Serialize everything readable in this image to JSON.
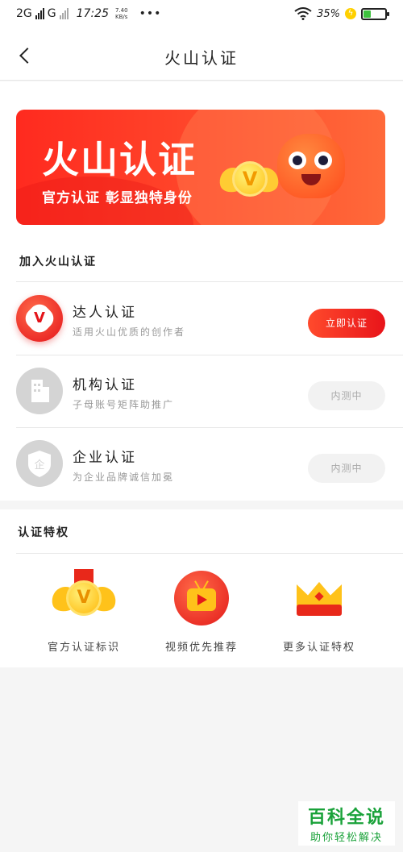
{
  "status_bar": {
    "network": "2G",
    "network2": "G",
    "time": "17:25",
    "speed_value": "7.40",
    "speed_unit": "KB/s",
    "overflow": "•••",
    "battery_text": "35%",
    "battery_level_percent": 35,
    "charging_icon": "bolt-icon"
  },
  "nav": {
    "back_icon": "chevron-left-icon",
    "title": "火山认证"
  },
  "banner": {
    "title": "火山认证",
    "subtitle": "官方认证 彰显独特身份"
  },
  "join_section": {
    "title": "加入火山认证",
    "items": [
      {
        "name": "达人认证",
        "desc": "适用火山优质的创作者",
        "button": "立即认证",
        "state": "active",
        "icon": "verified-badge-icon"
      },
      {
        "name": "机构认证",
        "desc": "子母账号矩阵助推广",
        "button": "内测中",
        "state": "disabled",
        "icon": "building-icon"
      },
      {
        "name": "企业认证",
        "desc": "为企业品牌诚信加冕",
        "button": "内测中",
        "state": "disabled",
        "icon": "enterprise-shield-icon"
      }
    ]
  },
  "privilege_section": {
    "title": "认证特权",
    "items": [
      {
        "label": "官方认证标识",
        "icon": "medal-icon"
      },
      {
        "label": "视频优先推荐",
        "icon": "video-icon"
      },
      {
        "label": "更多认证特权",
        "icon": "crown-icon"
      }
    ]
  },
  "watermark": {
    "title": "百科全说",
    "subtitle": "助你轻松解决"
  },
  "colors": {
    "accent": "#e8141a",
    "banner_start": "#ff2a1f",
    "banner_end": "#ff6a3a",
    "muted_button_bg": "#f2f2f2",
    "watermark_green": "#1aa23a"
  }
}
